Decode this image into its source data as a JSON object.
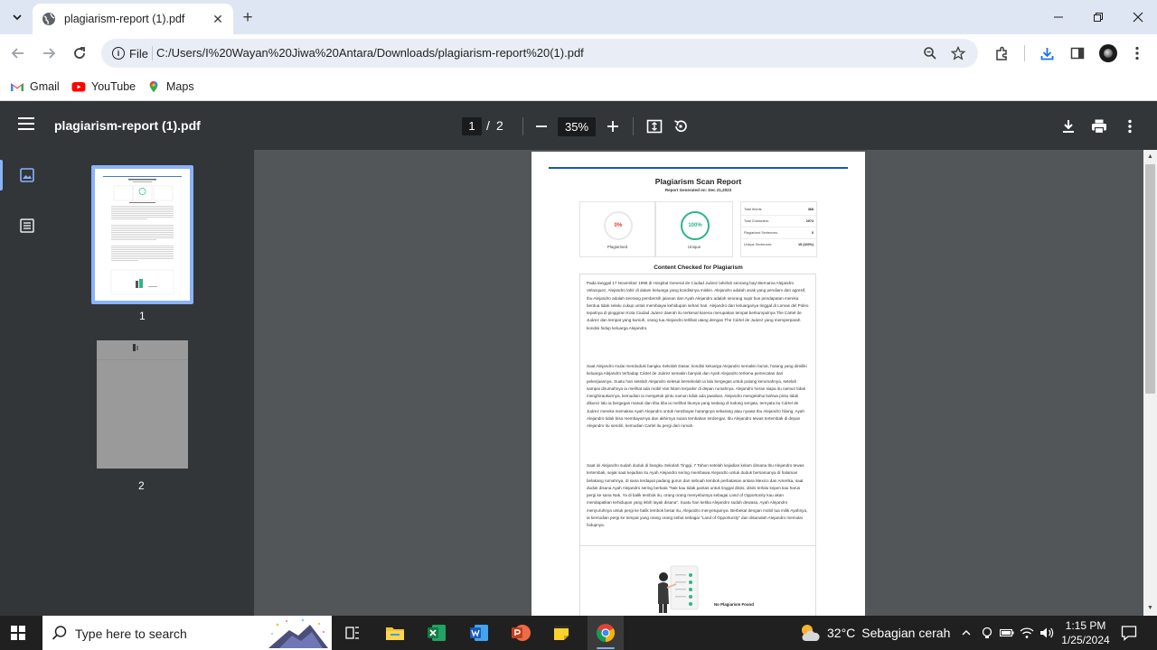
{
  "browser": {
    "tab_title": "plagiarism-report (1).pdf",
    "new_tab_label": "+",
    "address_scheme_label": "File",
    "url": "C:/Users/I%20Wayan%20Jiwa%20Antara/Downloads/plagiarism-report%20(1).pdf",
    "bookmarks": [
      {
        "label": "Gmail",
        "icon": "gmail-icon"
      },
      {
        "label": "YouTube",
        "icon": "youtube-icon"
      },
      {
        "label": "Maps",
        "icon": "maps-icon"
      }
    ]
  },
  "pdf_viewer": {
    "file_title": "plagiarism-report (1).pdf",
    "current_page": "1",
    "page_separator": "/",
    "total_pages": "2",
    "zoom": "35%",
    "thumbnails": [
      "1",
      "2"
    ]
  },
  "report": {
    "title": "Plagiarism Scan Report",
    "generated": "Report Generated on: Dec 21,2023",
    "plagiarised_percent": "0%",
    "plagiarised_label": "Plagiarised",
    "unique_percent": "100%",
    "unique_label": "Unique",
    "stats": [
      {
        "label": "Total Words:",
        "value": "368"
      },
      {
        "label": "Total Characters:",
        "value": "2074"
      },
      {
        "label": "Plagiarized Sentences:",
        "value": "0"
      },
      {
        "label": "Unique Sentences:",
        "value": "15 (100%)"
      }
    ],
    "content_heading": "Content Checked for Plagiarism",
    "paragraphs": [
      "Pada tanggal 17 November 1998 di Hospital General de Ciudad Juárez lahirlah seorang bayi Bernama Alejandro Velazquez, Alejandro lahir di dalam keluarga yang kondisinya miskin. Alejandro adalah anak yang pendiam dan agresif, Ibu Alejandro adalah seorang pembersih jalanan dan Ayah Alejandro adalah seorang supir bus pendapatan mereka berdua tidak selalu cukup untuk membiayai kehidupan sehari hari. Alejandro dan keluarganya tinggal di Lomas del Poleo tepatnya di pinggiran Kota Ciudad Juárez daerah itu terkenal karena merupakan tempat berkumpulnya The Cártel de Juárez dan tempat yang kumuh, orang tua Alejandro terlibat utang dengan The Cártel de Juárez yang memperparah kondisi hidup keluarga Alejandro.",
      "Saat Alejandro mulai menduduki bangku Sekolah Dasar, kondisi keluarga Alejandro semakin buruk, hutang yang dimiliki keluarga Alejandro terhadap Cártel de Juárez semakin banyak dan Ayah Alejandro terkena pemecatan dari pekerjaannya. Suatu hari setelah Alejandro selesai bersekolah ia lalu bergegas untuk pulang kerumahnya, setelah sampai dirumahnya ia melihat ada mobil Van hitam terparkir di depan rumahnya. Alejandro heran siapa itu namun tidak menghiraukannya, kemudian ia mengetuk pintu namun tidak ada jawaban, Alejandro mengetahui bahwa pintu tidak dikunci lalu ia bergegas masuk dan tiba tiba ia melihat Ibunya yang sedang di todong senjata, ternyata itu Cártel de Juárez mereka memaksa Ayah Alejandro untuk membayar hutangnya sekarang atau nyawa Ibu Alejandro hilang, Ayah Alejandro tidak bisa membayarnya dan akhirnya suara tembakan terdengar, Ibu Alejandro tewas tertembak di depan Alejandro itu sendiri, kemudian Cartel itu pergi dari rumah.",
      "Saat ini Alejandro sudah duduk di bangku Sekolah Tinggi, 7 Tahun setelah kejadian kelam dimana Ibu Alejandro tewas tertembak, sejak saat kejadian itu Ayah Alejandro sering membawa Alejandro untuk duduk bersamanya di halaman belakang rumahnya, di sana terdapat padang gurun dan sebuah tembok perbatasan antara Mexico dan Amerika, saat duduk disana Ayah Alejandro sering berkata \"Nak kau tidak pantas untuk tinggal disini, disini terlalu kejam kau harus pergi ke sana Nak. Ya di balik tembok itu, orang orang menyebutnya sebagai Land of Opportunity kau akan mendapatkan kehidupan yang lebih layak disana\". Suatu hari ketika Alejandro sudah dewasa, Ayah Alejandro menyuruhnya untuk pergi ke balik tembok besar itu, Alejandro menyetujuinya. Berbekal dengan mobil tua milik Ayahnya, ia kemudian pergi ke tempat yang orang orang sebut sebagai \"Land of Opportunity\" dan disanalah Alejandro memulai hidupnya."
    ],
    "no_plagiarism_label": "No Plagiarism Found",
    "colors": {
      "plagiarised": "#e53935",
      "unique": "#2fb58a",
      "accent": "#1a56b4"
    }
  },
  "taskbar": {
    "search_placeholder": "Type here to search",
    "apps": [
      "task-view-icon",
      "file-explorer-icon",
      "excel-icon",
      "word-icon",
      "powerpoint-icon",
      "sticky-notes-icon",
      "chrome-icon"
    ],
    "weather_temp": "32°C",
    "weather_desc": "Sebagian cerah",
    "time": "1:15 PM",
    "date": "1/25/2024"
  }
}
